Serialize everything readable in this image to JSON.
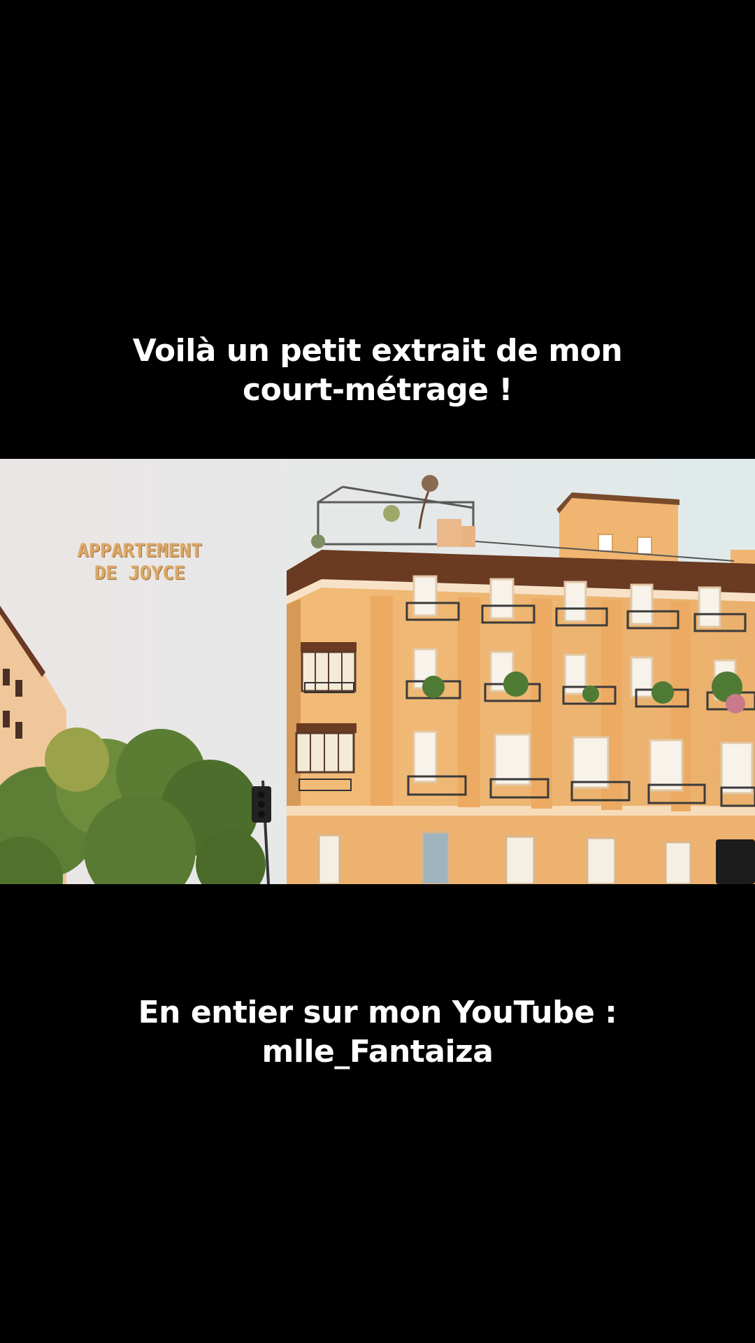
{
  "captions": {
    "top": {
      "line1": "Voilà un petit extrait de mon",
      "line2": "court-métrage !"
    },
    "bottom": {
      "line1": "En entier sur mon YouTube :",
      "line2": "mlle_Fantaiza"
    }
  },
  "video": {
    "location_title": {
      "line1": "APPARTEMENT",
      "line2": "DE JOYCE"
    }
  },
  "colors": {
    "background": "#000000",
    "caption_text": "#ffffff",
    "sky": "#ebe6e6",
    "building_facade": "#f0b670",
    "title_text": "#d9a86a"
  }
}
